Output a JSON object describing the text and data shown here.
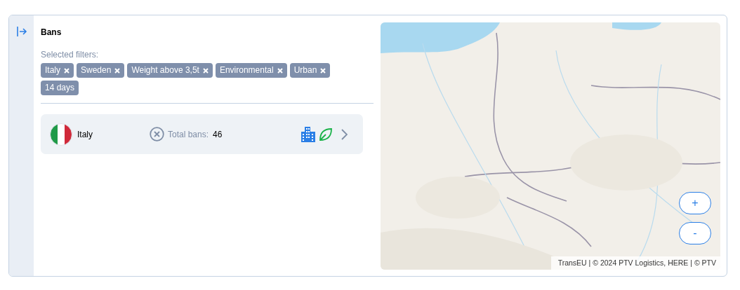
{
  "title": "Bans",
  "filters_label": "Selected filters:",
  "filters": [
    {
      "label": "Italy",
      "removable": true
    },
    {
      "label": "Sweden",
      "removable": true
    },
    {
      "label": "Weight above 3,5t",
      "removable": true
    },
    {
      "label": "Environmental",
      "removable": true
    },
    {
      "label": "Urban",
      "removable": true
    },
    {
      "label": "14 days",
      "removable": false
    }
  ],
  "countries": [
    {
      "name": "Italy",
      "total_label": "Total bans:",
      "total": "46",
      "ban_types": [
        {
          "kind": "urban"
        },
        {
          "kind": "environmental"
        }
      ]
    }
  ],
  "map": {
    "kind": "picture",
    "zoom_in": "+",
    "zoom_out": "-",
    "attribution": "TransEU | © 2024 PTV Logistics, HERE | © PTV"
  }
}
